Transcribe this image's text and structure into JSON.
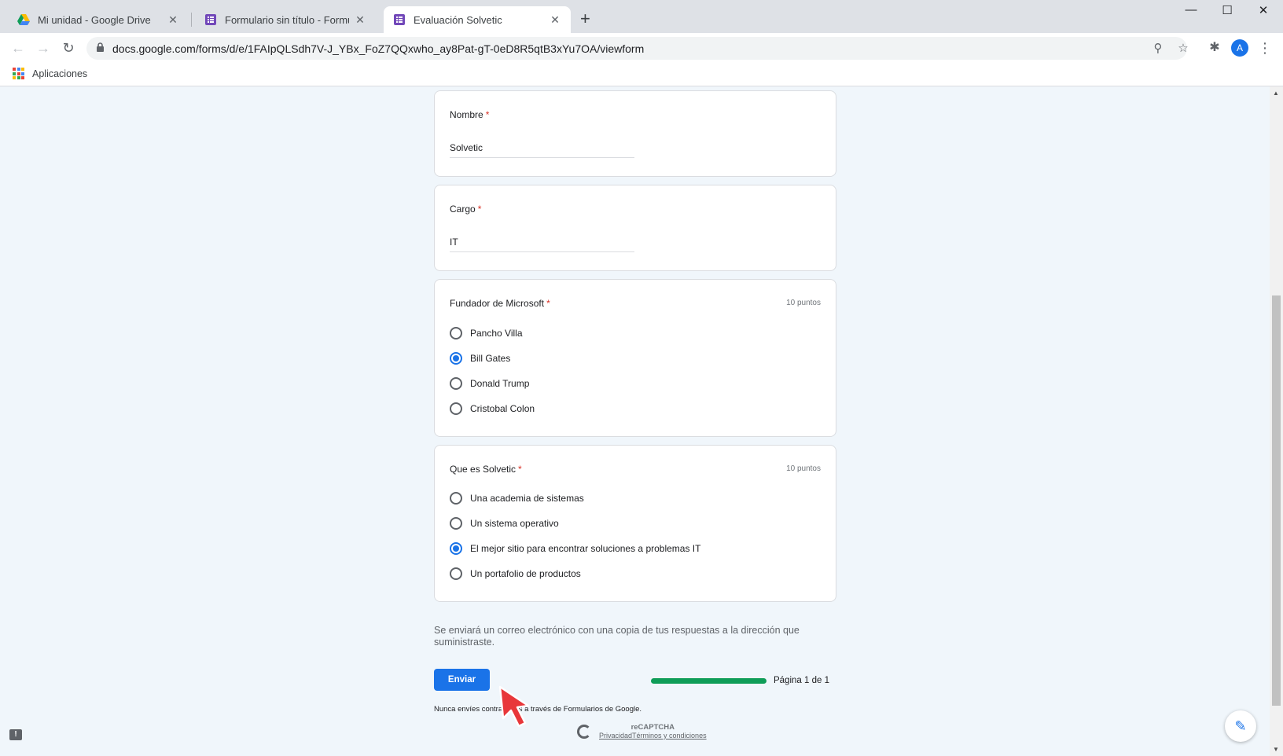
{
  "browser": {
    "tabs": [
      {
        "title": "Mi unidad - Google Drive",
        "icon": "google-drive-icon",
        "active": false
      },
      {
        "title": "Formulario sin título - Formularios de Google",
        "icon": "google-forms-icon",
        "active": false
      },
      {
        "title": "Evaluación Solvetic",
        "icon": "google-forms-icon",
        "active": true
      }
    ],
    "new_tab": "+",
    "url": "docs.google.com/forms/d/e/1FAIpQLSdh7V-J_YBx_FoZ7QQxwho_ay8Pat-gT-0eD8R5qtB3xYu7OA/viewform",
    "profile_initial": "A",
    "bookmark_apps": "Aplicaciones"
  },
  "form": {
    "questions": [
      {
        "title": "Nombre",
        "required": "*",
        "answer": "Solvetic"
      },
      {
        "title": "Cargo",
        "required": "*",
        "answer": "IT"
      },
      {
        "title": "Fundador de Microsoft",
        "required": "*",
        "points": "10 puntos",
        "options": [
          "Pancho Villa",
          "Bill Gates",
          "Donald Trump",
          "Cristobal Colon"
        ],
        "selected": 1
      },
      {
        "title": "Que es Solvetic",
        "required": "*",
        "points": "10 puntos",
        "options": [
          "Una academia de sistemas",
          "Un sistema operativo",
          "El mejor sitio para encontrar soluciones a problemas IT",
          "Un portafolio de productos"
        ],
        "selected": 2
      }
    ],
    "email_notice": "Se enviará un correo electrónico con una copia de tus respuestas a la dirección que suministraste.",
    "submit_label": "Enviar",
    "progress_fraction": 1.0,
    "page_indicator": "Página 1 de 1",
    "never_send": "Nunca envíes contraseñas a través de Formularios de Google.",
    "recaptcha": {
      "title": "reCAPTCHA",
      "privacy": "Privacidad",
      "terms": "Términos y condiciones"
    }
  },
  "colors": {
    "accent": "#1a73e8",
    "required": "#d93025",
    "progress": "#0f9d58",
    "background": "#f0f6fb"
  }
}
